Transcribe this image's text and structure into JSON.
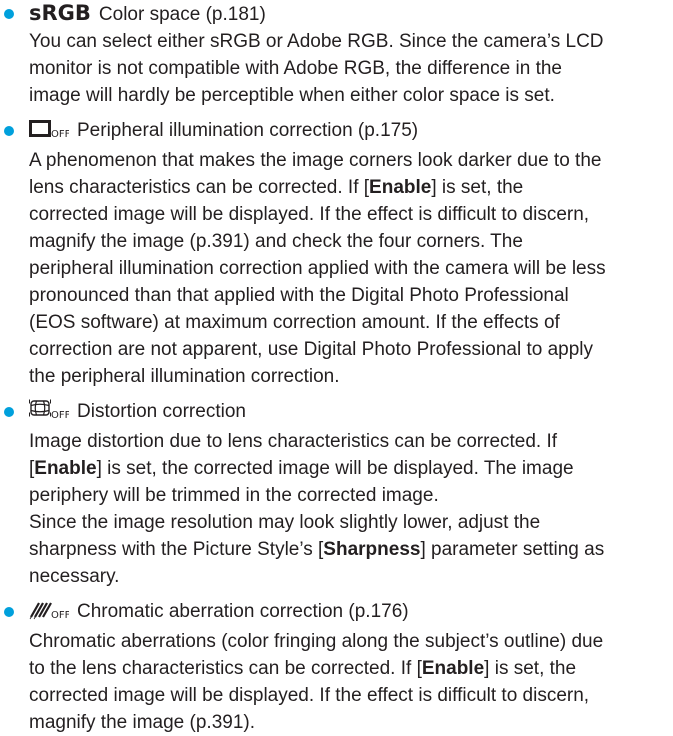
{
  "colors": {
    "bullet": "#00a0dc",
    "text": "#231f20"
  },
  "items": [
    {
      "icon": "sRGB",
      "title": "Color space (p.181)",
      "lines": [
        "You can select either sRGB or Adobe RGB. Since the camera’s LCD",
        "monitor is not compatible with Adobe RGB, the difference in the",
        "image will hardly be perceptible when either color space is set."
      ]
    },
    {
      "icon_name": "peripheral-illumination-off-icon",
      "title": "Peripheral illumination correction (p.175)",
      "line1": "A phenomenon that makes the image corners look darker due to the",
      "line2_pre": "lens characteristics can be corrected. If [",
      "line2_bold": "Enable",
      "line2_post": "] is set, the",
      "lines_rest": [
        "corrected image will be displayed. If the effect is difficult to discern,",
        "magnify the image (p.391) and check the four corners. The",
        "peripheral illumination correction applied with the camera will be less",
        "pronounced than that applied with the Digital Photo Professional",
        "(EOS software) at maximum correction amount. If the effects of",
        "correction are not apparent, use Digital Photo Professional to apply",
        "the peripheral illumination correction."
      ]
    },
    {
      "icon_name": "distortion-correction-off-icon",
      "title": "Distortion correction",
      "line1": "Image distortion due to lens characteristics can be corrected. If",
      "line2_pre": "[",
      "line2_bold": "Enable",
      "line2_post": "] is set, the corrected image will be displayed. The image",
      "line3": "periphery will be trimmed in the corrected image.",
      "line4": "Since the image resolution may look slightly lower, adjust the",
      "line5_pre": "sharpness with the Picture Style’s [",
      "line5_bold": "Sharpness",
      "line5_post": "] parameter setting as",
      "line6": "necessary."
    },
    {
      "icon_name": "chromatic-aberration-off-icon",
      "title": "Chromatic aberration correction (p.176)",
      "line1": "Chromatic aberrations (color fringing along the subject’s outline) due",
      "line2_pre": "to the lens characteristics can be corrected. If [",
      "line2_bold": "Enable",
      "line2_post": "] is set, the",
      "line3": "corrected image will be displayed. If the effect is difficult to discern,",
      "line4": "magnify the image (p.391)."
    }
  ]
}
